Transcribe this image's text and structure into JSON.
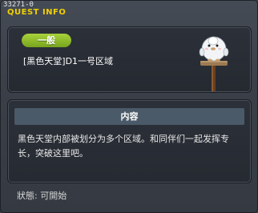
{
  "window": {
    "quest_id": "33271-0",
    "title": "QUEST INFO"
  },
  "header": {
    "badge_label": "一般",
    "quest_name": "[黑色天堂]D1一号区域",
    "mascot_icon": "penguin-on-signpost-icon"
  },
  "content": {
    "section_title": "内容",
    "description": "黑色天堂内部被划分为多个区域。和同伴们一起发挥专长，突破这里吧。"
  },
  "status": {
    "text": "狀態:  可開始"
  },
  "colors": {
    "title_yellow": "#f0d000",
    "badge_green": "#8fbf2a",
    "section_header": "#4b5a68",
    "panel_bg": "#2a2e36"
  }
}
